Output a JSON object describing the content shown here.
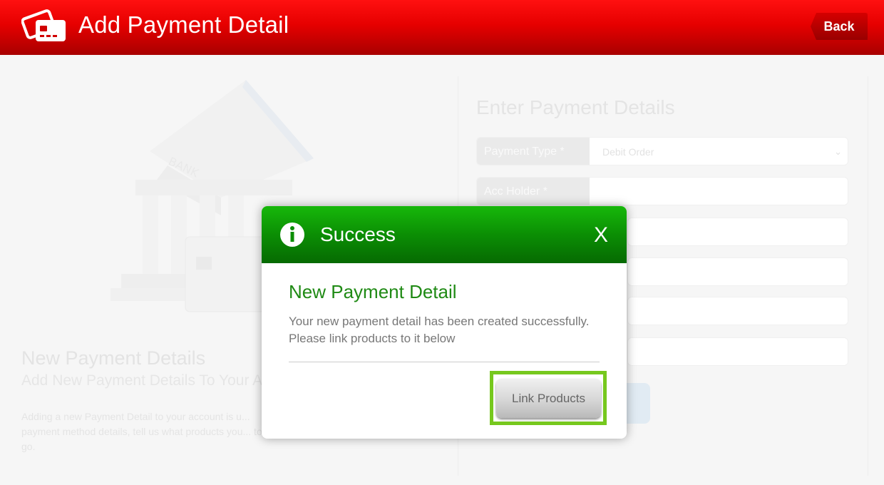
{
  "header": {
    "title": "Add Payment Detail",
    "back_label": "Back",
    "bar_color": "#e60000"
  },
  "background": {
    "heading": "New Payment Details",
    "subheading": "Add New Payment Details To Your Ac",
    "paragraph": "Adding a new Payment Detail to your account is u... payment method details, tell us what products you... to go.",
    "bank_label": "BANK",
    "form": {
      "heading": "Enter Payment Details",
      "rows": [
        {
          "label": "Payment Type *",
          "value": "Debit Order",
          "chevron": "⌄"
        },
        {
          "label": "Acc Holder *",
          "value": "",
          "chevron": ""
        }
      ]
    }
  },
  "modal": {
    "title": "Success",
    "close_label": "X",
    "heading": "New Payment Detail",
    "message": "Your new payment detail has been created successfully. Please link products to it below",
    "button_label": "Link Products",
    "header_color": "#0b8e04",
    "highlight_color": "#76c81e"
  }
}
